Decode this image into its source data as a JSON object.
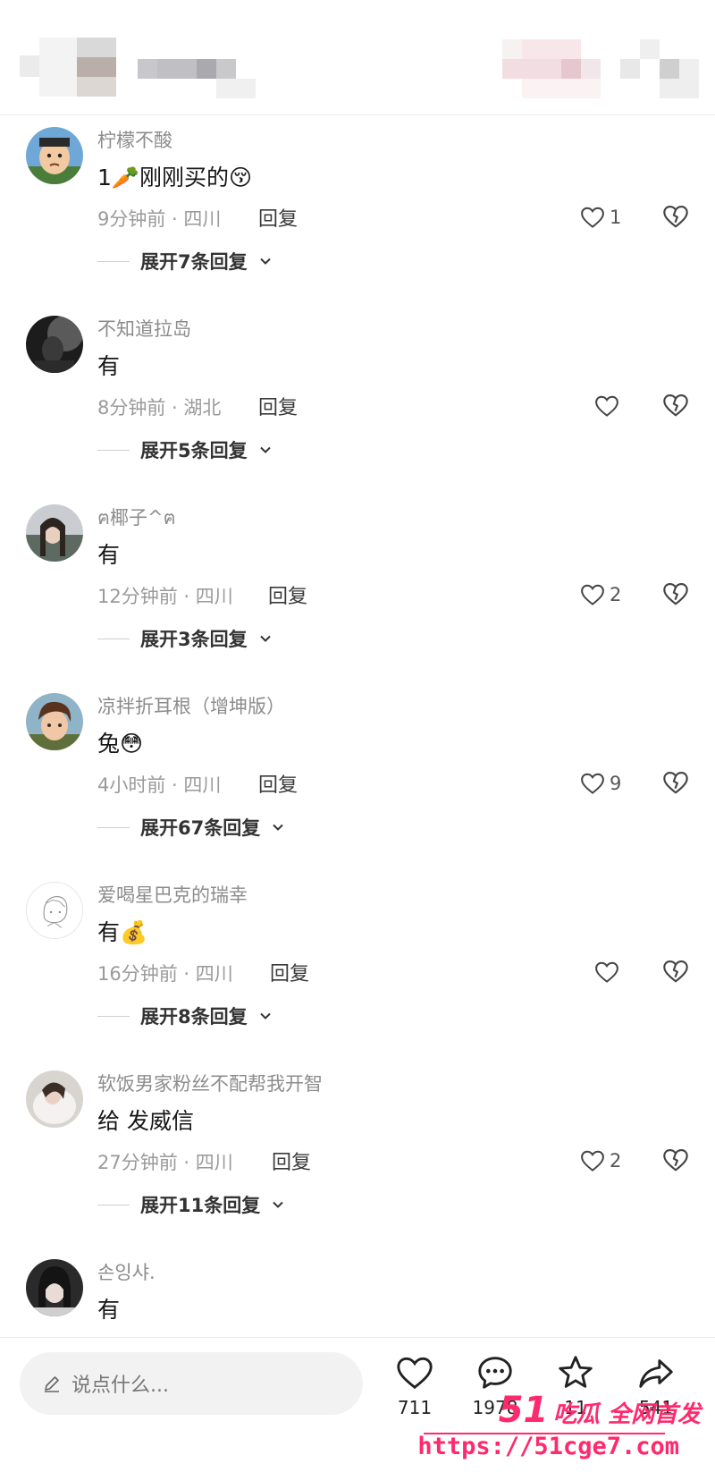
{
  "comments": [
    {
      "username": "柠檬不酸",
      "content": "1🥕刚刚买的😚",
      "meta": "9分钟前 · 四川",
      "reply": "回复",
      "likes": "1",
      "expand": "展开7条回复"
    },
    {
      "username": "不知道拉岛",
      "content": "有",
      "meta": "8分钟前 · 湖北",
      "reply": "回复",
      "likes": "",
      "expand": "展开5条回复"
    },
    {
      "username": "ฅ椰子^ฅ",
      "content": "有",
      "meta": "12分钟前 · 四川",
      "reply": "回复",
      "likes": "2",
      "expand": "展开3条回复"
    },
    {
      "username": "凉拌折耳根（增坤版）",
      "content": "兔😳",
      "meta": "4小时前 · 四川",
      "reply": "回复",
      "likes": "9",
      "expand": "展开67条回复"
    },
    {
      "username": "爱喝星巴克的瑞幸",
      "content": "有💰",
      "meta": "16分钟前 · 四川",
      "reply": "回复",
      "likes": "",
      "expand": "展开8条回复"
    },
    {
      "username": "软饭男家粉丝不配帮我开智",
      "content": "给 发威信",
      "meta": "27分钟前 · 四川",
      "reply": "回复",
      "likes": "2",
      "expand": "展开11条回复"
    },
    {
      "username": "손잉샤.",
      "content": "有",
      "meta": "",
      "reply": "",
      "likes": "",
      "expand": ""
    }
  ],
  "bottom_bar": {
    "input_placeholder": "说点什么...",
    "like_count": "711",
    "comment_count": "1978",
    "favorite_count": "11",
    "share_count": "541"
  },
  "watermark": {
    "title_number": "51",
    "title_text": "吃瓜 全网首发",
    "url": "https://51cge7.com"
  },
  "colors": {
    "watermark": "#ff2a6d",
    "username": "#8c8c8c",
    "meta": "#9a9a9a"
  },
  "icons": [
    "heart-icon",
    "broken-heart-icon",
    "chevron-down-icon",
    "pencil-icon",
    "comment-icon",
    "star-icon",
    "share-icon"
  ]
}
